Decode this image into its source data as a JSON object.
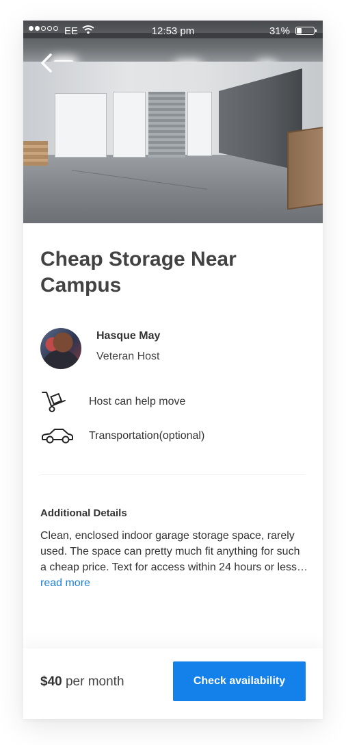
{
  "status_bar": {
    "carrier": "EE",
    "time": "12:53 pm",
    "battery_percent": "31%",
    "battery_level": 0.31,
    "signal_bars_filled": 2,
    "signal_bars_total": 5
  },
  "listing": {
    "title": "Cheap Storage Near Campus"
  },
  "host": {
    "name": "Hasque May",
    "role": "Veteran Host"
  },
  "features": [
    {
      "icon": "hand-truck-icon",
      "label": "Host can help move"
    },
    {
      "icon": "car-icon",
      "label": "Transportation(optional)"
    }
  ],
  "details": {
    "title": "Additional Details",
    "text": "Clean, enclosed indoor garage storage space, rarely used. The space can pretty much fit anything for such a cheap price. Text for access within 24 hours or less…",
    "read_more": "read more"
  },
  "booking": {
    "price": "$40",
    "period": "per month",
    "cta_label": "Check availability"
  },
  "colors": {
    "accent": "#1480ea",
    "link": "#1a7fe0"
  }
}
